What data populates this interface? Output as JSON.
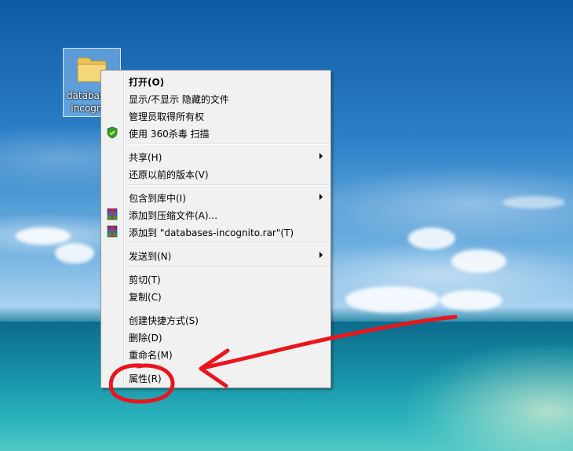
{
  "desktop": {
    "icon": {
      "label_line1": "databases-",
      "label_line2": "incognito",
      "icon": "folder-icon"
    }
  },
  "context_menu": {
    "items": [
      {
        "label": "打开(O)",
        "bold": true
      },
      {
        "label": "显示/不显示 隐藏的文件"
      },
      {
        "label": "管理员取得所有权"
      },
      {
        "label": "使用 360杀毒 扫描",
        "icon": "shield-icon"
      },
      {
        "label": "共享(H)",
        "submenu": true
      },
      {
        "label": "还原以前的版本(V)"
      },
      {
        "label": "包含到库中(I)",
        "submenu": true
      },
      {
        "label": "添加到压缩文件(A)...",
        "icon": "winrar-icon"
      },
      {
        "label": "添加到 \"databases-incognito.rar\"(T)",
        "icon": "winrar-icon"
      },
      {
        "label": "发送到(N)",
        "submenu": true
      },
      {
        "label": "剪切(T)"
      },
      {
        "label": "复制(C)"
      },
      {
        "label": "创建快捷方式(S)"
      },
      {
        "label": "删除(D)"
      },
      {
        "label": "重命名(M)"
      },
      {
        "label": "属性(R)"
      }
    ]
  },
  "colors": {
    "annotation_red": "#e8161c",
    "menu_background": "#f1f1f1"
  }
}
